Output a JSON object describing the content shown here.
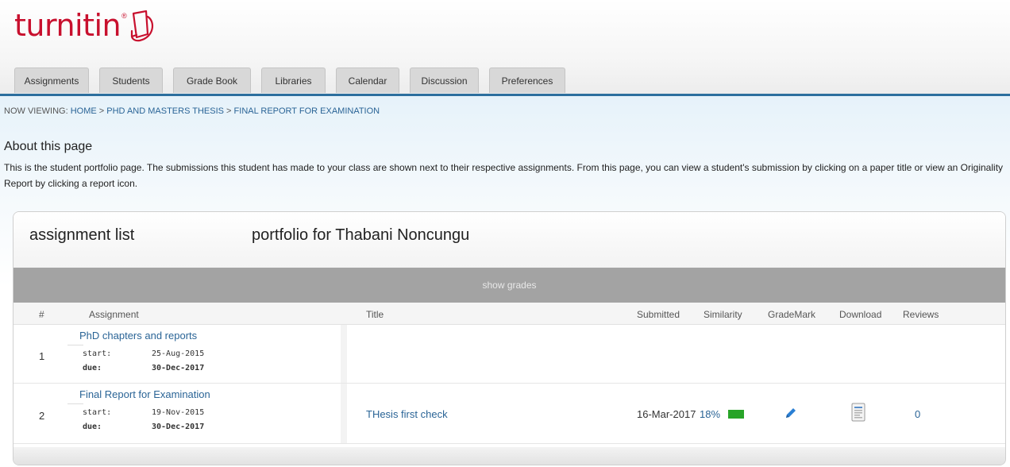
{
  "logo": {
    "text": "turnitin",
    "sup": "®"
  },
  "tabs": [
    {
      "label": "Assignments"
    },
    {
      "label": "Students"
    },
    {
      "label": "Grade Book"
    },
    {
      "label": "Libraries"
    },
    {
      "label": "Calendar"
    },
    {
      "label": "Discussion"
    },
    {
      "label": "Preferences"
    }
  ],
  "breadcrumb": {
    "prefix": "NOW VIEWING: ",
    "home": "HOME",
    "sep1": " > ",
    "class": "PHD AND MASTERS THESIS",
    "sep2": " > ",
    "current": "FINAL REPORT FOR EXAMINATION"
  },
  "about": {
    "title": "About this page",
    "text": "This is the student portfolio page. The submissions this student has made to your class are shown next to their respective assignments. From this page, you can view a student's submission by clicking on a paper title or view an Originality Report by clicking a report icon."
  },
  "panel": {
    "list_label": "assignment list",
    "portfolio_label": "portfolio for Thabani Noncungu",
    "show_grades": "show grades"
  },
  "columns": {
    "num": "#",
    "assignment": "Assignment",
    "title": "Title",
    "submitted": "Submitted",
    "similarity": "Similarity",
    "grademark": "GradeMark",
    "download": "Download",
    "reviews": "Reviews"
  },
  "rows": [
    {
      "num": "1",
      "assignment": "PhD chapters and reports",
      "start_label": "start:",
      "start": "25-Aug-2015",
      "due_label": "due:",
      "due": "30-Dec-2017"
    },
    {
      "num": "2",
      "assignment": "Final Report for Examination",
      "start_label": "start:",
      "start": "19-Nov-2015",
      "due_label": "due:",
      "due": "30-Dec-2017",
      "title": "THesis first check",
      "submitted": "16-Mar-2017",
      "similarity": "18%",
      "reviews": "0"
    }
  ],
  "colors": {
    "brand": "#c8102e",
    "link": "#2a6496",
    "similarity": "#28a428",
    "rule": "#2c6f9e"
  },
  "icons": {
    "grademark": "pencil-icon",
    "download": "document-icon"
  }
}
